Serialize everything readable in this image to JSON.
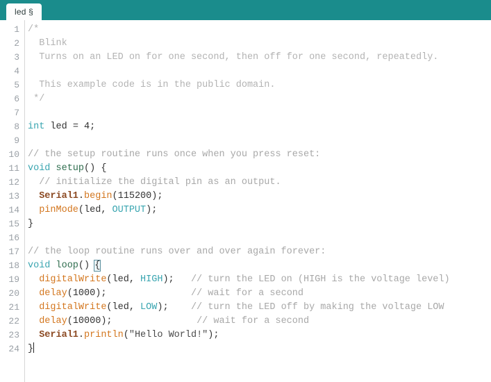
{
  "window": {
    "header_color": "#1a8c8c",
    "background": "#ffffff"
  },
  "tabbar": {
    "tabs": [
      {
        "label": "led §",
        "active": true
      }
    ]
  },
  "editor": {
    "language": "arduino-cpp",
    "cursor_line": 24,
    "total_lines": 24,
    "brace_match_line": 18,
    "colors": {
      "comment": "#b3b3b3",
      "keyword": "#39a5b0",
      "function": "#2f6e4f",
      "builtin": "#d3761e",
      "library": "#8c4a23",
      "constant": "#39a5b0",
      "plain": "#333333",
      "line_number": "#9aa0a6"
    },
    "lines": [
      {
        "n": "1",
        "text": "/*"
      },
      {
        "n": "2",
        "text": "  Blink"
      },
      {
        "n": "3",
        "text": "  Turns on an LED on for one second, then off for one second, repeatedly."
      },
      {
        "n": "4",
        "text": ""
      },
      {
        "n": "5",
        "text": "  This example code is in the public domain."
      },
      {
        "n": "6",
        "text": " */"
      },
      {
        "n": "7",
        "text": ""
      },
      {
        "n": "8",
        "text": "int led = 4;"
      },
      {
        "n": "9",
        "text": ""
      },
      {
        "n": "10",
        "text": "// the setup routine runs once when you press reset:"
      },
      {
        "n": "11",
        "text": "void setup() {"
      },
      {
        "n": "12",
        "text": "  // initialize the digital pin as an output."
      },
      {
        "n": "13",
        "text": "  Serial1.begin(115200);"
      },
      {
        "n": "14",
        "text": "  pinMode(led, OUTPUT);"
      },
      {
        "n": "15",
        "text": "}"
      },
      {
        "n": "16",
        "text": ""
      },
      {
        "n": "17",
        "text": "// the loop routine runs over and over again forever:"
      },
      {
        "n": "18",
        "text": "void loop() {"
      },
      {
        "n": "19",
        "text": "  digitalWrite(led, HIGH);   // turn the LED on (HIGH is the voltage level)"
      },
      {
        "n": "20",
        "text": "  delay(1000);               // wait for a second"
      },
      {
        "n": "21",
        "text": "  digitalWrite(led, LOW);    // turn the LED off by making the voltage LOW"
      },
      {
        "n": "22",
        "text": "  delay(10000);               // wait for a second"
      },
      {
        "n": "23",
        "text": "  Serial1.println(\"Hello World!\");"
      },
      {
        "n": "24",
        "text": "}"
      }
    ],
    "tokens": {
      "l1_comment": "/*",
      "l2_comment": "  Blink",
      "l3_comment": "  Turns on an LED on for one second, then off for one second, repeatedly.",
      "l5_comment": "  This example code is in the public domain.",
      "l6_comment": " */",
      "l8_kw": "int",
      "l8_rest": " led = 4;",
      "l10_comment": "// the setup routine runs once when you press reset:",
      "l11_kw": "void",
      "l11_fn": " setup",
      "l11_rest": "() {",
      "l12_comment": "  // initialize the digital pin as an output.",
      "l13_indent": "  ",
      "l13_lib": "Serial1",
      "l13_dot": ".",
      "l13_method": "begin",
      "l13_rest": "(115200);",
      "l14_indent": "  ",
      "l14_builtin": "pinMode",
      "l14_mid": "(led, ",
      "l14_const": "OUTPUT",
      "l14_end": ");",
      "l15_text": "}",
      "l17_comment": "// the loop routine runs over and over again forever:",
      "l18_kw": "void",
      "l18_fn": " loop",
      "l18_paren": "() ",
      "l18_brace": "{",
      "l19_indent": "  ",
      "l19_builtin": "digitalWrite",
      "l19_mid": "(led, ",
      "l19_const": "HIGH",
      "l19_end": ");",
      "l19_pad": "   ",
      "l19_comment": "// turn the LED on (HIGH is the voltage level)",
      "l20_indent": "  ",
      "l20_builtin": "delay",
      "l20_rest": "(1000);",
      "l20_pad": "               ",
      "l20_comment": "// wait for a second",
      "l21_indent": "  ",
      "l21_builtin": "digitalWrite",
      "l21_mid": "(led, ",
      "l21_const": "LOW",
      "l21_end": ");",
      "l21_pad": "    ",
      "l21_comment": "// turn the LED off by making the voltage LOW",
      "l22_indent": "  ",
      "l22_builtin": "delay",
      "l22_rest": "(10000);",
      "l22_pad": "               ",
      "l22_comment": "// wait for a second",
      "l23_indent": "  ",
      "l23_lib": "Serial1",
      "l23_dot": ".",
      "l23_method": "println",
      "l23_open": "(",
      "l23_string": "\"Hello World!\"",
      "l23_end": ");",
      "l24_text": "}"
    }
  }
}
